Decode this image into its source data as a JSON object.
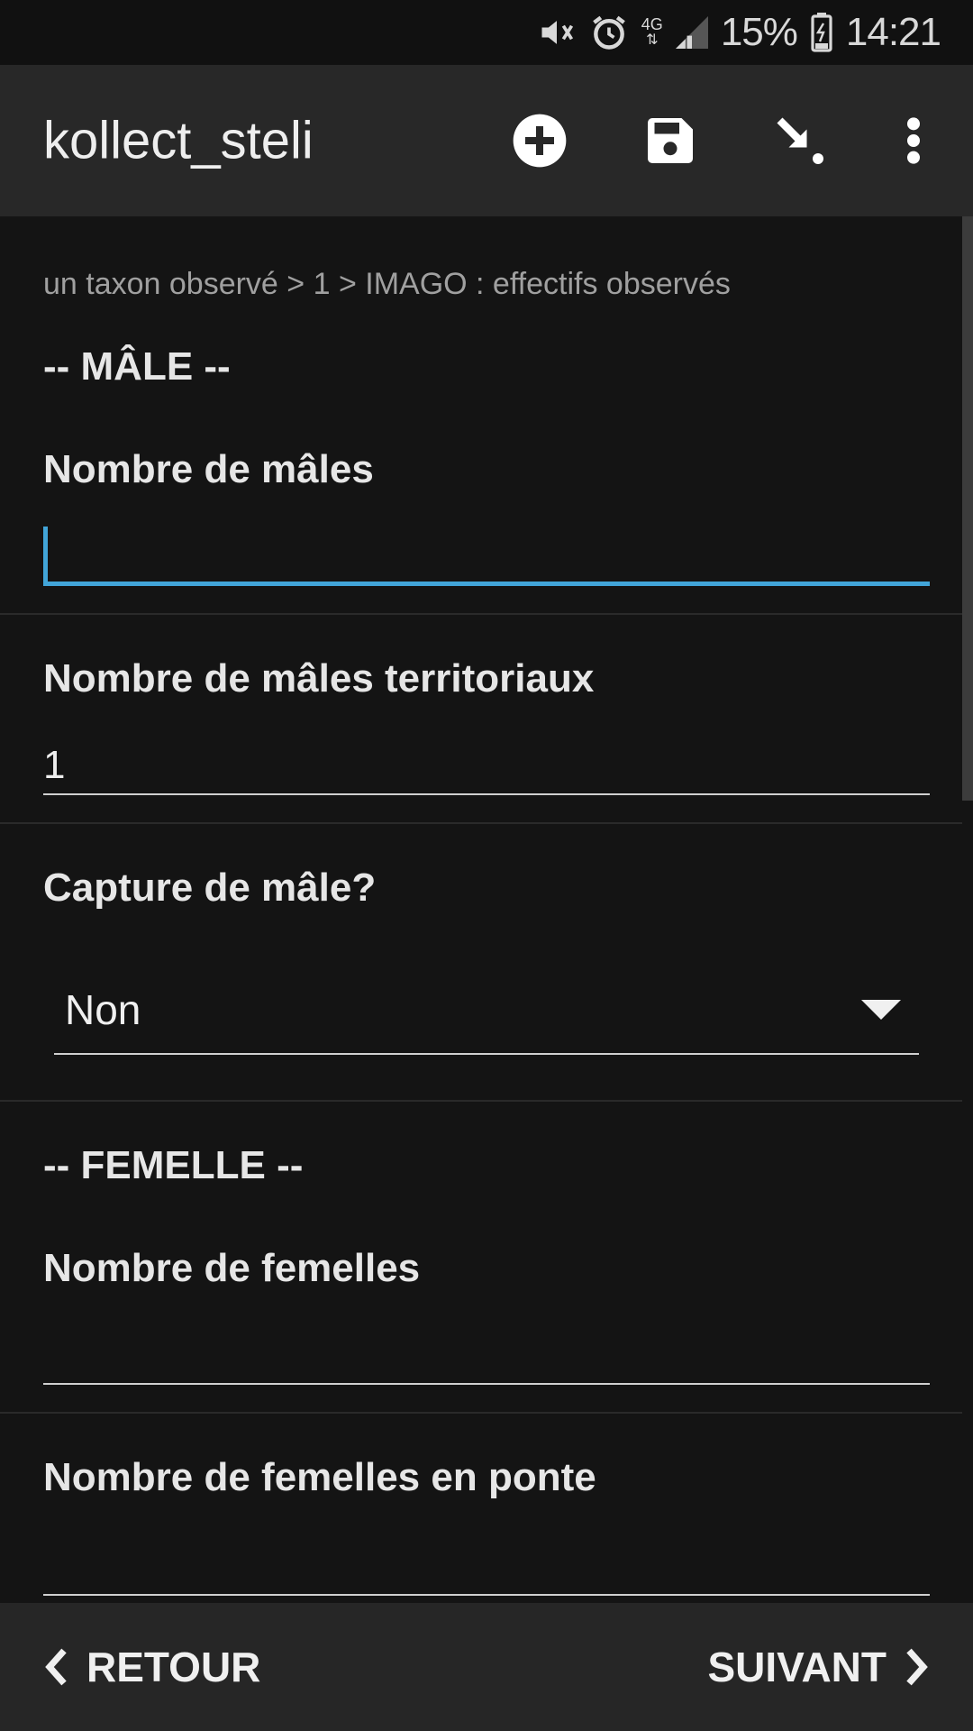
{
  "status_bar": {
    "battery_percent": "15%",
    "time": "14:21",
    "network": "4G",
    "icons": [
      "mute-vibrate-icon",
      "alarm-icon",
      "network-4g-icon",
      "signal-icon",
      "battery-icon"
    ]
  },
  "app_bar": {
    "title": "kollect_steli",
    "actions": [
      "add-circle-icon",
      "save-icon",
      "jump-icon",
      "more-vert-icon"
    ]
  },
  "breadcrumb": "un taxon observé > 1 > IMAGO : effectifs observés",
  "sections": {
    "male_heading": "-- MÂLE --",
    "female_heading": "-- FEMELLE --"
  },
  "fields": {
    "nb_males": {
      "label": "Nombre de mâles",
      "value": ""
    },
    "nb_males_territoriaux": {
      "label": "Nombre de mâles territoriaux",
      "value": "1"
    },
    "capture_male": {
      "label": "Capture de mâle?",
      "selected": "Non"
    },
    "nb_femelles": {
      "label": "Nombre de femelles",
      "value": ""
    },
    "nb_femelles_ponte": {
      "label": "Nombre de femelles en ponte",
      "value": ""
    }
  },
  "bottom_nav": {
    "back_label": "RETOUR",
    "next_label": "SUIVANT"
  },
  "colors": {
    "accent": "#42a5d9",
    "background": "#141414",
    "app_bar": "#282828",
    "bottom_bar": "#262626"
  }
}
